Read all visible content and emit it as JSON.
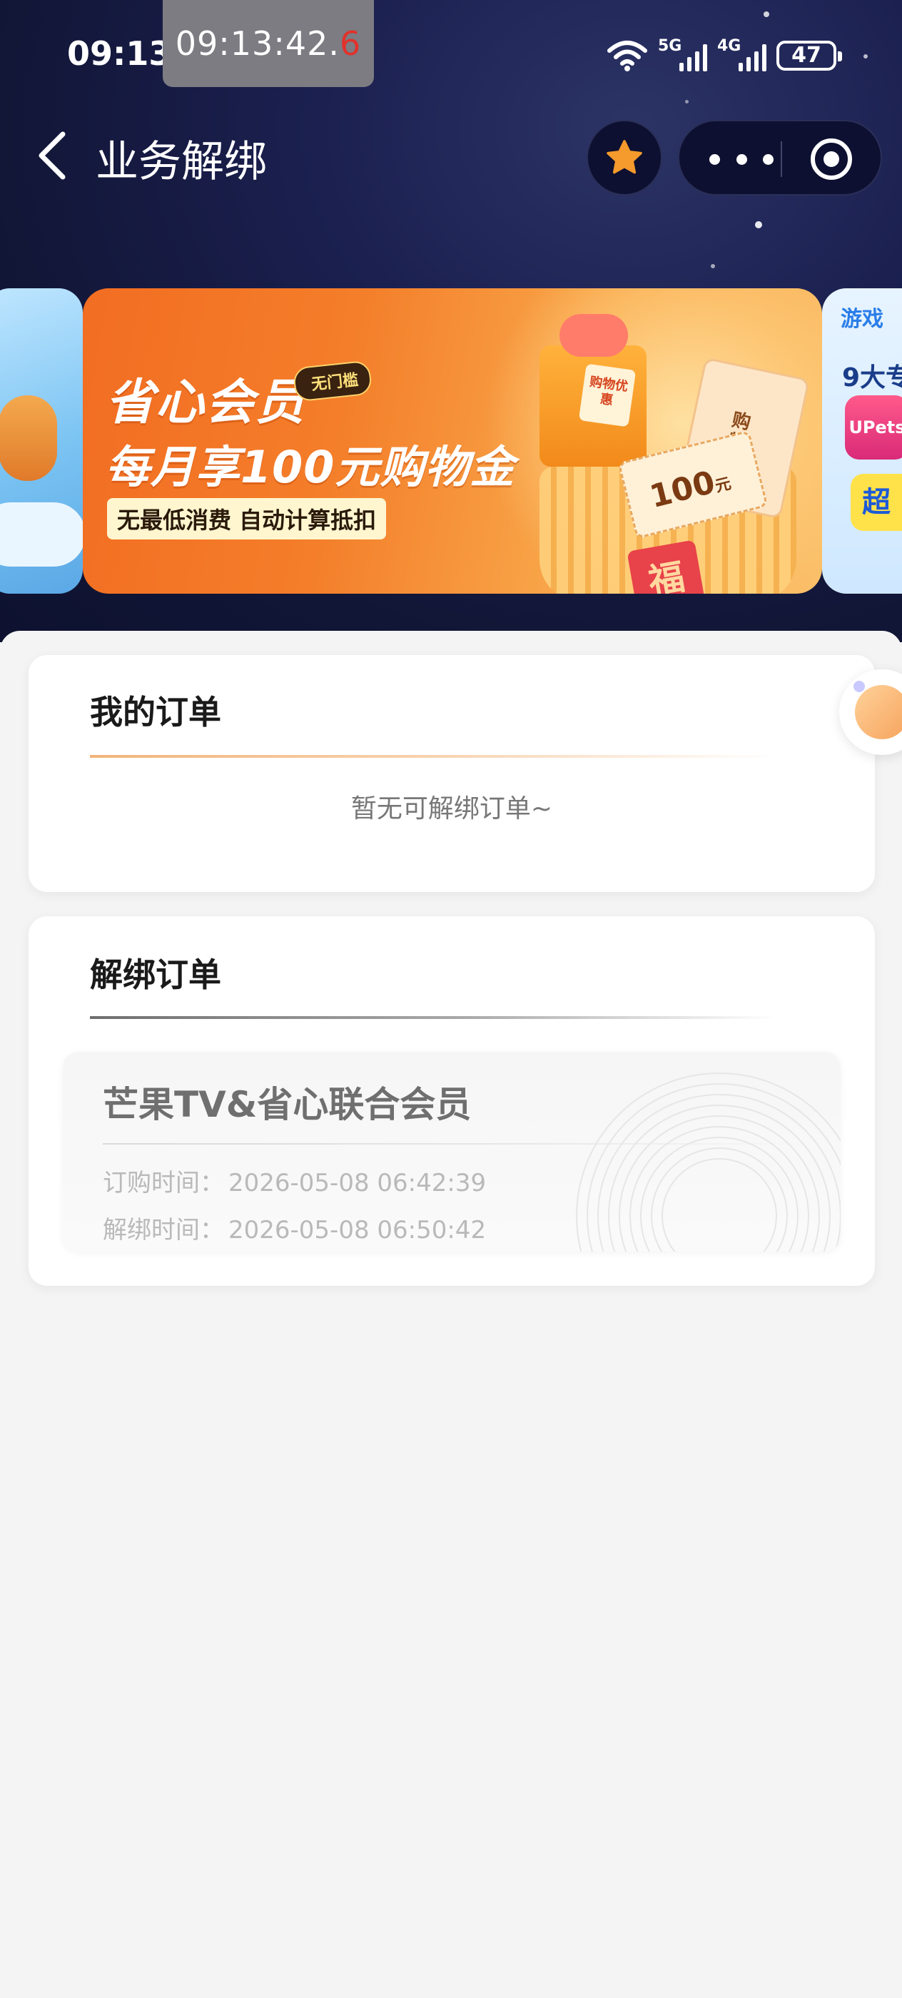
{
  "status_bar": {
    "time": "09:13",
    "clock_overlay": "09:13:42.",
    "clock_overlay_fraction": "6",
    "signal_1_label": "5G",
    "signal_2_label": "4G",
    "battery": "47"
  },
  "nav": {
    "title": "业务解绑",
    "back_icon": "chevron-left-icon",
    "favorite_icon": "star-icon",
    "more_icon": "more-dots-icon",
    "close_icon": "target-circle-icon"
  },
  "banner": {
    "title": "省心会员",
    "badge": "无门槛",
    "subtitle": "每月享100元购物金",
    "note": "无最低消费 自动计算抵扣",
    "gift_tag": "购物优惠",
    "coupon_amount": "100",
    "coupon_unit": "元",
    "card_label": "购物金",
    "fu": "福",
    "right_brand": "游戏",
    "right_headline": "9大专",
    "right_app": "UPets",
    "right_super": "超",
    "accent_color": "#f26d22"
  },
  "my_orders": {
    "title": "我的订单",
    "empty": "暂无可解绑订单~"
  },
  "unbind_orders": {
    "title": "解绑订单",
    "items": [
      {
        "name": "芒果TV&省心联合会员",
        "subscribe_label": "订购时间：",
        "subscribe_time": "2026-05-08 06:42:39",
        "unbind_label": "解绑时间：",
        "unbind_time": "2026-05-08 06:50:42"
      }
    ]
  }
}
